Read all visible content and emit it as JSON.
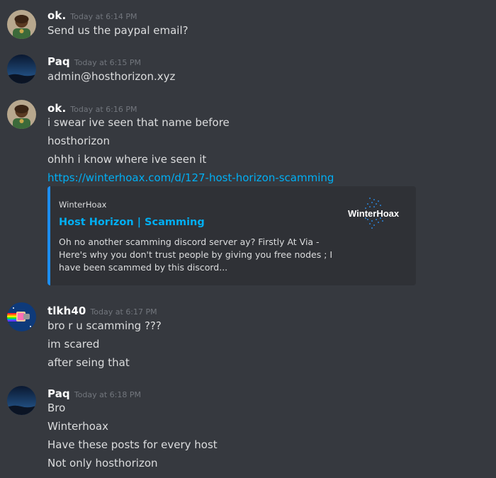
{
  "messages": [
    {
      "username": "ok.",
      "timestamp": "Today at 6:14 PM",
      "lines": [
        "Send us the paypal email?"
      ]
    },
    {
      "username": "Paq",
      "timestamp": "Today at 6:15 PM",
      "lines": [
        "admin@hosthorizon.xyz"
      ]
    },
    {
      "username": "ok.",
      "timestamp": "Today at 6:16 PM",
      "lines": [
        "i swear ive seen that name before",
        "hosthorizon",
        "ohhh i know where ive seen it"
      ],
      "link": "https://winterhoax.com/d/127-host-horizon-scamming",
      "embed": {
        "provider": "WinterHoax",
        "title": "Host Horizon | Scamming",
        "description": "Oh no another scamming discord server ay? Firstly At Via - Here's why you don't trust people by giving you free nodes ; I have been scammed by this discord...",
        "thumbnail_text": "WinterHoax"
      }
    },
    {
      "username": "tlkh40",
      "timestamp": "Today at 6:17 PM",
      "lines": [
        "bro r u scamming ???",
        "im scared",
        "after seing that"
      ]
    },
    {
      "username": "Paq",
      "timestamp": "Today at 6:18 PM",
      "lines": [
        "Bro",
        "Winterhoax",
        "Have these posts for every host",
        "Not only hosthorizon"
      ]
    }
  ],
  "colors": {
    "background": "#36393f",
    "embed_background": "#2f3136",
    "embed_accent": "#1d8ef0",
    "link": "#00aff4",
    "timestamp": "#72767d"
  }
}
